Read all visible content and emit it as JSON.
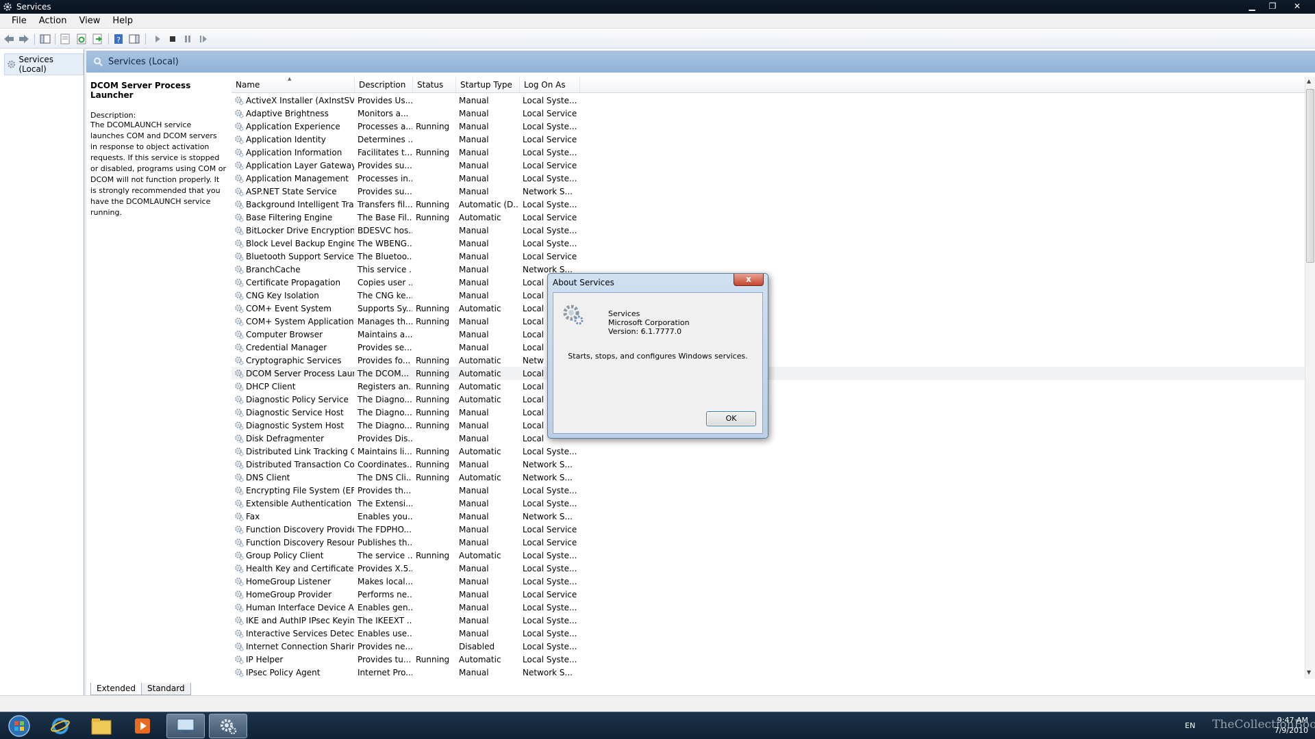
{
  "window": {
    "title": "Services"
  },
  "menu": [
    "File",
    "Action",
    "View",
    "Help"
  ],
  "toolbar": [
    "back-icon",
    "forward-icon",
    "show-hide-tree-icon",
    "properties-icon",
    "refresh-icon",
    "export-list-icon",
    "help-icon",
    "show-action-pane-icon",
    "start-service-icon",
    "stop-service-icon",
    "pause-service-icon",
    "restart-service-icon"
  ],
  "tree": {
    "root_label": "Services (Local)"
  },
  "header": {
    "title": "Services (Local)"
  },
  "description_panel": {
    "service_name": "DCOM Server Process Launcher",
    "label": "Description:",
    "text": "The DCOMLAUNCH service launches COM and DCOM servers in response to object activation requests. If this service is stopped or disabled, programs using COM or DCOM will not function properly. It is strongly recommended that you have the DCOMLAUNCH service running."
  },
  "columns": [
    "Name",
    "Description",
    "Status",
    "Startup Type",
    "Log On As"
  ],
  "services": [
    [
      "ActiveX Installer (AxInstSV)",
      "Provides Us...",
      "",
      "Manual",
      "Local Syste..."
    ],
    [
      "Adaptive Brightness",
      "Monitors a...",
      "",
      "Manual",
      "Local Service"
    ],
    [
      "Application Experience",
      "Processes a...",
      "Running",
      "Manual",
      "Local Syste..."
    ],
    [
      "Application Identity",
      "Determines ...",
      "",
      "Manual",
      "Local Service"
    ],
    [
      "Application Information",
      "Facilitates t...",
      "Running",
      "Manual",
      "Local Syste..."
    ],
    [
      "Application Layer Gateway ...",
      "Provides su...",
      "",
      "Manual",
      "Local Service"
    ],
    [
      "Application Management",
      "Processes in...",
      "",
      "Manual",
      "Local Syste..."
    ],
    [
      "ASP.NET State Service",
      "Provides su...",
      "",
      "Manual",
      "Network S..."
    ],
    [
      "Background Intelligent Tran...",
      "Transfers fil...",
      "Running",
      "Automatic (D...",
      "Local Syste..."
    ],
    [
      "Base Filtering Engine",
      "The Base Fil...",
      "Running",
      "Automatic",
      "Local Service"
    ],
    [
      "BitLocker Drive Encryption ...",
      "BDESVC hos...",
      "",
      "Manual",
      "Local Syste..."
    ],
    [
      "Block Level Backup Engine ...",
      "The WBENG...",
      "",
      "Manual",
      "Local Syste..."
    ],
    [
      "Bluetooth Support Service",
      "The Bluetoo...",
      "",
      "Manual",
      "Local Service"
    ],
    [
      "BranchCache",
      "This service ...",
      "",
      "Manual",
      "Network S..."
    ],
    [
      "Certificate Propagation",
      "Copies user ...",
      "",
      "Manual",
      "Local"
    ],
    [
      "CNG Key Isolation",
      "The CNG ke...",
      "",
      "Manual",
      "Local"
    ],
    [
      "COM+ Event System",
      "Supports Sy...",
      "Running",
      "Automatic",
      "Local"
    ],
    [
      "COM+ System Application",
      "Manages th...",
      "Running",
      "Manual",
      "Local"
    ],
    [
      "Computer Browser",
      "Maintains a...",
      "",
      "Manual",
      "Local"
    ],
    [
      "Credential Manager",
      "Provides se...",
      "",
      "Manual",
      "Local"
    ],
    [
      "Cryptographic Services",
      "Provides fo...",
      "Running",
      "Automatic",
      "Netw"
    ],
    [
      "DCOM Server Process Laun...",
      "The DCOM...",
      "Running",
      "Automatic",
      "Local"
    ],
    [
      "DHCP Client",
      "Registers an...",
      "Running",
      "Automatic",
      "Local"
    ],
    [
      "Diagnostic Policy Service",
      "The Diagno...",
      "Running",
      "Automatic",
      "Local"
    ],
    [
      "Diagnostic Service Host",
      "The Diagno...",
      "Running",
      "Manual",
      "Local"
    ],
    [
      "Diagnostic System Host",
      "The Diagno...",
      "Running",
      "Manual",
      "Local"
    ],
    [
      "Disk Defragmenter",
      "Provides Dis...",
      "",
      "Manual",
      "Local"
    ],
    [
      "Distributed Link Tracking Cl...",
      "Maintains li...",
      "Running",
      "Automatic",
      "Local Syste..."
    ],
    [
      "Distributed Transaction Co...",
      "Coordinates...",
      "Running",
      "Manual",
      "Network S..."
    ],
    [
      "DNS Client",
      "The DNS Cli...",
      "Running",
      "Automatic",
      "Network S..."
    ],
    [
      "Encrypting File System (EFS)",
      "Provides th...",
      "",
      "Manual",
      "Local Syste..."
    ],
    [
      "Extensible Authentication P...",
      "The Extensi...",
      "",
      "Manual",
      "Local Syste..."
    ],
    [
      "Fax",
      "Enables you...",
      "",
      "Manual",
      "Network S..."
    ],
    [
      "Function Discovery Provide...",
      "The FDPHO...",
      "",
      "Manual",
      "Local Service"
    ],
    [
      "Function Discovery Resourc...",
      "Publishes th...",
      "",
      "Manual",
      "Local Service"
    ],
    [
      "Group Policy Client",
      "The service ...",
      "Running",
      "Automatic",
      "Local Syste..."
    ],
    [
      "Health Key and Certificate ...",
      "Provides X.5...",
      "",
      "Manual",
      "Local Syste..."
    ],
    [
      "HomeGroup Listener",
      "Makes local...",
      "",
      "Manual",
      "Local Syste..."
    ],
    [
      "HomeGroup Provider",
      "Performs ne...",
      "",
      "Manual",
      "Local Service"
    ],
    [
      "Human Interface Device Ac...",
      "Enables gen...",
      "",
      "Manual",
      "Local Syste..."
    ],
    [
      "IKE and AuthIP IPsec Keying...",
      "The IKEEXT ...",
      "",
      "Manual",
      "Local Syste..."
    ],
    [
      "Interactive Services Detection",
      "Enables use...",
      "",
      "Manual",
      "Local Syste..."
    ],
    [
      "Internet Connection Sharin...",
      "Provides ne...",
      "",
      "Disabled",
      "Local Syste..."
    ],
    [
      "IP Helper",
      "Provides tu...",
      "Running",
      "Automatic",
      "Local Syste..."
    ],
    [
      "IPsec Policy Agent",
      "Internet Pro...",
      "",
      "Manual",
      "Network S..."
    ]
  ],
  "selected_index": 21,
  "tabs": [
    "Extended",
    "Standard"
  ],
  "dialog": {
    "title": "About Services",
    "close_label": "x",
    "product": "Services",
    "company": "Microsoft Corporation",
    "version": "Version: 6.1.7777.0",
    "description": "Starts, stops, and configures Windows services.",
    "ok_label": "OK"
  },
  "taskbar": {
    "items": [
      "start-orb-icon",
      "internet-explorer-icon",
      "windows-explorer-icon",
      "media-player-icon",
      "remote-desktop-icon",
      "services-gear-icon"
    ],
    "lang": "EN",
    "time": "9:47 AM",
    "date": "7/9/2010",
    "watermark": "TheCollectionBook"
  },
  "colors": {
    "header": "#9bbbdc",
    "titlebar": "#0d1a2a",
    "taskbar": "#16293d",
    "selection": "#f1f2f4"
  }
}
